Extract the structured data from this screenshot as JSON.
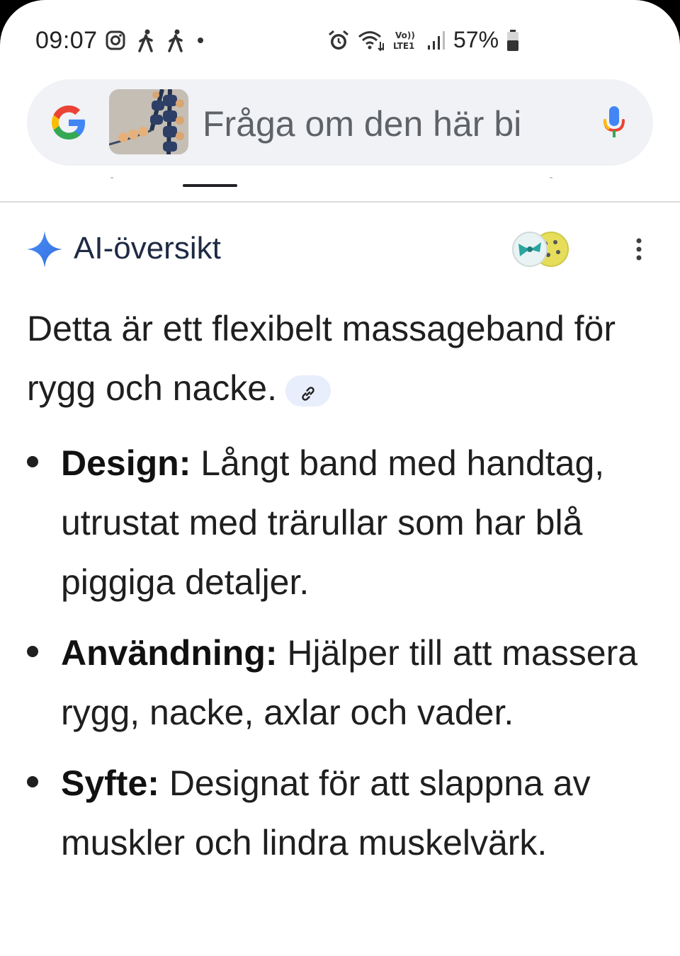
{
  "status_bar": {
    "time": "09:07",
    "battery": "57%",
    "icons": [
      "instagram-icon",
      "walking-icon",
      "walking-icon",
      "dot",
      "alarm-icon",
      "wifi-icon",
      "volte-icon",
      "signal-icon",
      "battery-icon"
    ]
  },
  "search": {
    "placeholder": "Fråga om den här bi",
    "logo": "google-g-icon",
    "mic": "mic-icon"
  },
  "ai_overview": {
    "title": "AI-översikt",
    "intro": "Detta är ett flexibelt massageband för rygg och nacke.",
    "bullets": [
      {
        "label": "Design:",
        "text": " Långt band med handtag, utrustat med trärullar som har blå piggiga detaljer."
      },
      {
        "label": "Användning:",
        "text": " Hjälper till att massera rygg, nacke, axlar och vader."
      },
      {
        "label": "Syfte:",
        "text": " Designat för att slappna av muskler och lindra muskelvärk."
      }
    ]
  },
  "colors": {
    "accent_blue": "#4285F4",
    "search_bg": "#f0f2f5",
    "link_chip_bg": "#e8eefb",
    "text": "#1f1f1f"
  }
}
